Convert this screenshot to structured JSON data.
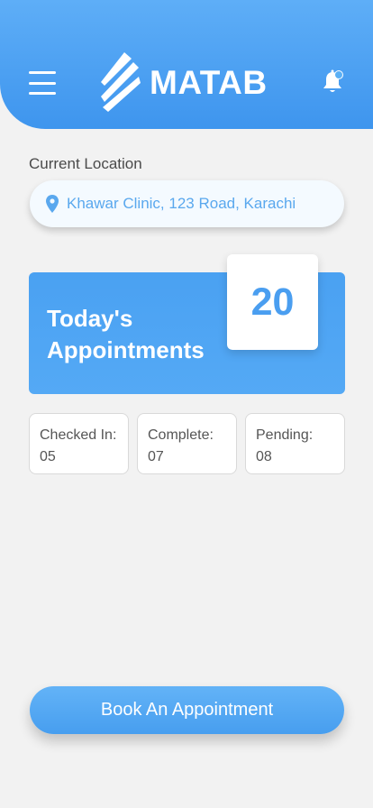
{
  "header": {
    "app_name": "MATAB",
    "menu_icon": "hamburger-menu-icon",
    "notification_icon": "bell-icon",
    "notification_indicator": true
  },
  "location": {
    "label": "Current Location",
    "value": "Khawar Clinic, 123 Road, Karachi",
    "icon": "map-pin-icon"
  },
  "appointments": {
    "title_line1": "Today's",
    "title_line2": "Appointments",
    "count": "20"
  },
  "stats": [
    {
      "label": "Checked In:",
      "value": "05"
    },
    {
      "label": "Complete:",
      "value": "07"
    },
    {
      "label": "Pending:",
      "value": "08"
    }
  ],
  "book_button_label": "Book An Appointment",
  "colors": {
    "primary": "#4a9ef0",
    "background": "#f2f2f2",
    "white": "#ffffff"
  }
}
